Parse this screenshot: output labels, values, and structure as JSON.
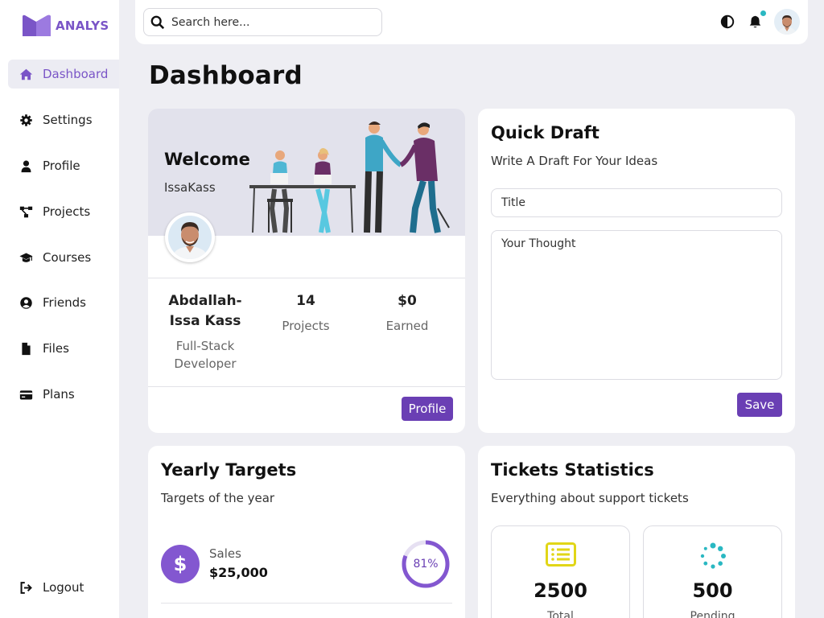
{
  "app": {
    "brand": "ANALYS"
  },
  "sidebar": {
    "items": [
      {
        "label": "Dashboard",
        "icon": "home-icon",
        "active": true
      },
      {
        "label": "Settings",
        "icon": "gear-icon"
      },
      {
        "label": "Profile",
        "icon": "user-icon"
      },
      {
        "label": "Projects",
        "icon": "diagram-icon"
      },
      {
        "label": "Courses",
        "icon": "graduation-cap-icon"
      },
      {
        "label": "Friends",
        "icon": "user-circle-icon"
      },
      {
        "label": "Files",
        "icon": "file-icon"
      },
      {
        "label": "Plans",
        "icon": "credit-card-icon"
      }
    ],
    "logout": {
      "label": "Logout",
      "icon": "logout-icon"
    }
  },
  "topbar": {
    "search_placeholder": "Search here...",
    "notification_dot_color": "#2ab8c2"
  },
  "page": {
    "title": "Dashboard"
  },
  "welcome": {
    "title": "Welcome",
    "username": "IssaKass",
    "name": "Abdallah-Issa Kass",
    "role": "Full-Stack Developer",
    "projects_value": "14",
    "projects_label": "Projects",
    "earned_value": "$0",
    "earned_label": "Earned",
    "profile_button": "Profile"
  },
  "draft": {
    "title": "Quick Draft",
    "subtitle": "Write A Draft For Your Ideas",
    "title_placeholder": "Title",
    "body_placeholder": "Your Thought",
    "save_button": "Save"
  },
  "targets": {
    "title": "Yearly Targets",
    "subtitle": "Targets of the year",
    "sales_label": "Sales",
    "sales_value": "$25,000",
    "progress_text": "81%",
    "progress": 0.81
  },
  "tickets": {
    "title": "Tickets Statistics",
    "subtitle": "Everything about support tickets",
    "boxes": [
      {
        "value": "2500",
        "label": "Total",
        "icon": "list-icon",
        "color": "#e1d617"
      },
      {
        "value": "500",
        "label": "Pending",
        "icon": "spinner-icon",
        "color": "#2ab8c2"
      }
    ]
  },
  "colors": {
    "accent": "#7a55c7",
    "button": "#6a3fb4",
    "background": "#eeeef3"
  }
}
